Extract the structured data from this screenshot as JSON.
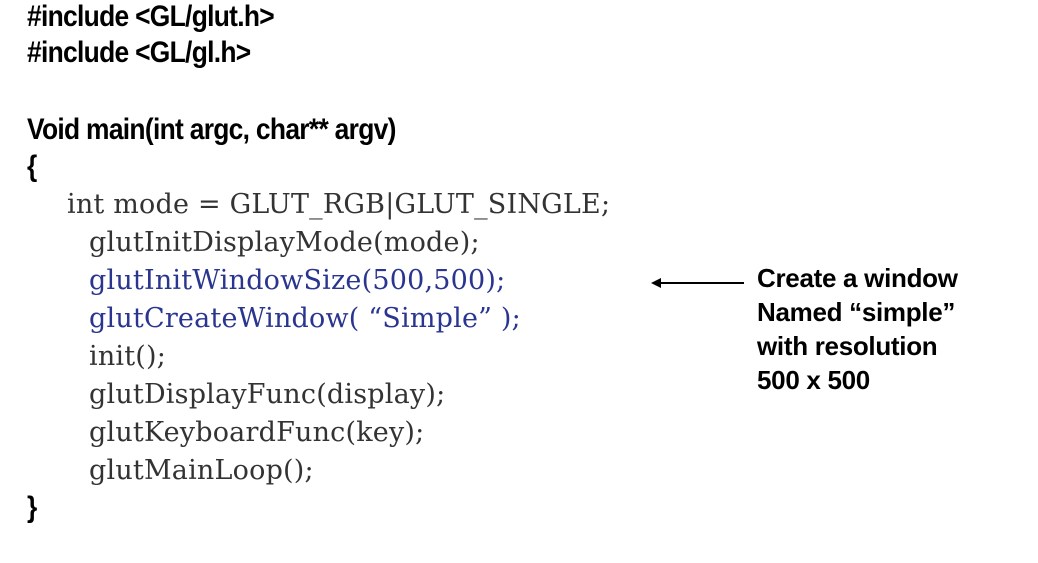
{
  "colors": {
    "default": "#333333",
    "highlight": "#2a3590",
    "header": "#000000"
  },
  "header_lines": [
    "#include <GL/glut.h>",
    "#include <GL/gl.h>",
    "Void main(int argc, char** argv)",
    "{"
  ],
  "code_lines": [
    {
      "text": "int mode = GLUT_RGB|GLUT_SINGLE;",
      "highlight": false
    },
    {
      "text": "glutInitDisplayMode(mode);",
      "highlight": false
    },
    {
      "text": "glutInitWindowSize(500,500);",
      "highlight": true
    },
    {
      "text": "glutCreateWindow( “Simple” );",
      "highlight": true
    },
    {
      "text": "init();",
      "highlight": false
    },
    {
      "text": "glutDisplayFunc(display);",
      "highlight": false
    },
    {
      "text": "glutKeyboardFunc(key);",
      "highlight": false
    },
    {
      "text": "glutMainLoop();",
      "highlight": false
    }
  ],
  "closing_brace": "}",
  "annotation": {
    "lines": [
      "Create a window",
      "Named “simple”",
      "with resolution",
      "500 x 500"
    ],
    "arrow_icon": "left-arrow-icon"
  }
}
